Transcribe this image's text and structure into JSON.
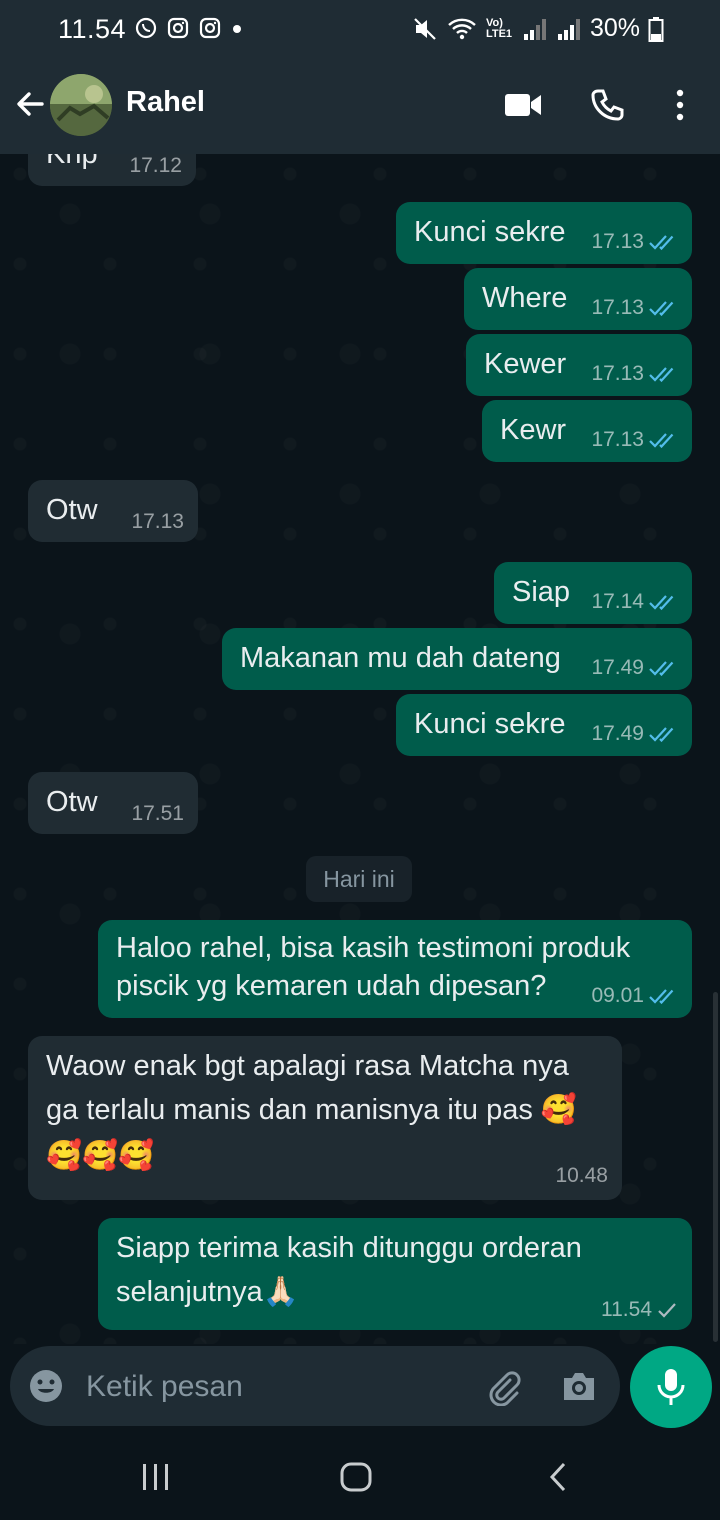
{
  "status_bar": {
    "time": "11.54",
    "battery": "30%",
    "network": "Vo) LTE1"
  },
  "header": {
    "contact_name": "Rahel",
    "icons": [
      "back-arrow-icon",
      "video-call-icon",
      "phone-icon",
      "more-vert-icon"
    ]
  },
  "messages": [
    {
      "dir": "in",
      "text": "Knp",
      "time": "17.12"
    },
    {
      "dir": "out",
      "text": "Kunci sekre",
      "time": "17.13",
      "status": "read"
    },
    {
      "dir": "out",
      "text": "Where",
      "time": "17.13",
      "status": "read"
    },
    {
      "dir": "out",
      "text": "Kewer",
      "time": "17.13",
      "status": "read"
    },
    {
      "dir": "out",
      "text": "Kewr",
      "time": "17.13",
      "status": "read"
    },
    {
      "dir": "in",
      "text": "Otw",
      "time": "17.13"
    },
    {
      "dir": "out",
      "text": "Siap",
      "time": "17.14",
      "status": "read"
    },
    {
      "dir": "out",
      "text": "Makanan mu dah dateng",
      "time": "17.49",
      "status": "read"
    },
    {
      "dir": "out",
      "text": "Kunci sekre",
      "time": "17.49",
      "status": "read"
    },
    {
      "dir": "in",
      "text": "Otw",
      "time": "17.51"
    },
    {
      "dir": "out",
      "line1": "Haloo rahel, bisa kasih testimoni produk",
      "line2": "piscik yg kemaren udah dipesan?",
      "time": "09.01",
      "status": "read"
    },
    {
      "dir": "in",
      "line1": "Waow enak bgt apalagi rasa Matcha nya",
      "line2": "ga terlalu manis dan manisnya itu pas 🥰",
      "line3": "🥰🥰🥰",
      "time": "10.48"
    },
    {
      "dir": "out",
      "line1": "Siapp terima kasih ditunggu orderan",
      "line2": "selanjutnya🙏🏻",
      "time": "11.54",
      "status": "sent"
    }
  ],
  "day_divider": "Hari ini",
  "composer": {
    "placeholder": "Ketik pesan"
  },
  "colors": {
    "outgoing_bubble": "#005c4b",
    "incoming_bubble": "#202c33",
    "read_tick": "#53bdeb",
    "mic_button": "#00a884"
  }
}
